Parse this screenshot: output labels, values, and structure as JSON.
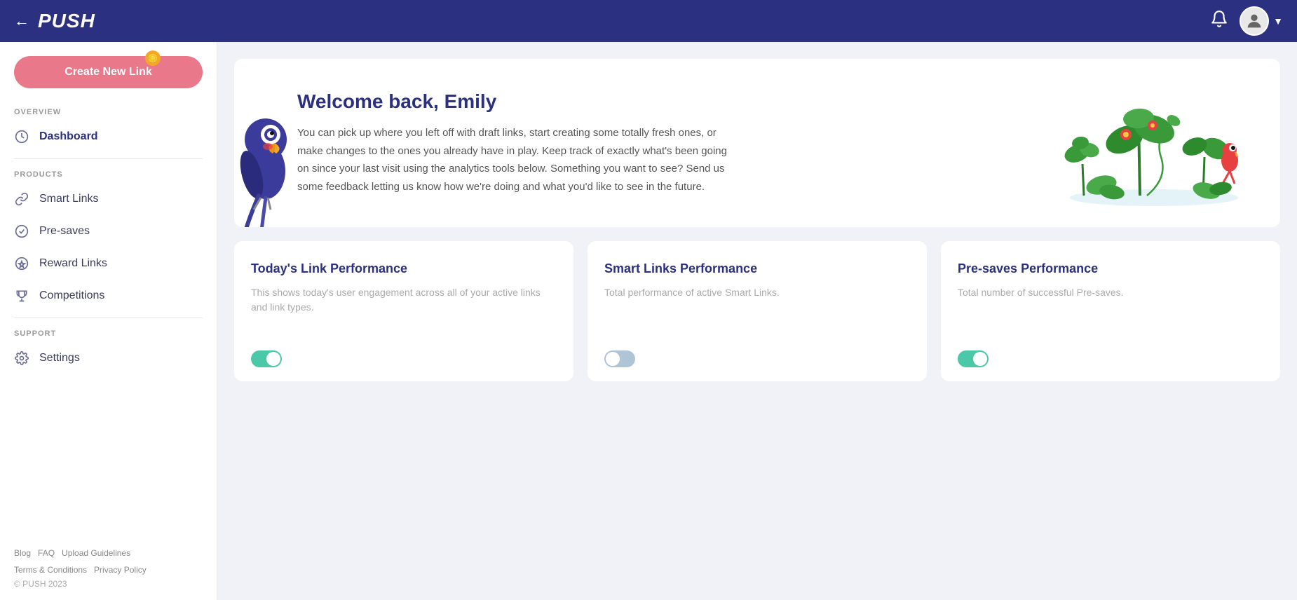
{
  "topnav": {
    "logo": "PUSH",
    "back_label": "←"
  },
  "sidebar": {
    "create_button_label": "Create New Link",
    "sections": [
      {
        "label": "OVERVIEW",
        "items": [
          {
            "id": "dashboard",
            "label": "Dashboard",
            "icon": "gauge"
          }
        ]
      },
      {
        "label": "PRODUCTS",
        "items": [
          {
            "id": "smart-links",
            "label": "Smart Links",
            "icon": "link"
          },
          {
            "id": "pre-saves",
            "label": "Pre-saves",
            "icon": "circle-check"
          },
          {
            "id": "reward-links",
            "label": "Reward Links",
            "icon": "star"
          },
          {
            "id": "competitions",
            "label": "Competitions",
            "icon": "trophy"
          }
        ]
      },
      {
        "label": "SUPPORT",
        "items": [
          {
            "id": "settings",
            "label": "Settings",
            "icon": "gear"
          }
        ]
      }
    ],
    "footer_links": [
      "Blog",
      "FAQ",
      "Upload Guidelines",
      "Terms & Conditions",
      "Privacy Policy"
    ],
    "copyright": "© PUSH 2023"
  },
  "welcome": {
    "title": "Welcome back, Emily",
    "body": "You can pick up where you left off with draft links, start creating some totally fresh ones, or make changes to the ones you already have in play. Keep track of exactly what's been going on since your last visit using the analytics tools below. Something you want to see? Send us some feedback letting us know how we're doing and what you'd like to see in the future."
  },
  "cards": [
    {
      "id": "todays-link-performance",
      "title": "Today's Link Performance",
      "subtitle": "This shows today's user engagement across all of your active links and link types.",
      "toggle": "on"
    },
    {
      "id": "smart-links-performance",
      "title": "Smart Links Performance",
      "subtitle": "Total performance of active Smart Links.",
      "toggle": "off"
    },
    {
      "id": "pre-saves-performance",
      "title": "Pre-saves Performance",
      "subtitle": "Total number of successful Pre-saves.",
      "toggle": "on"
    }
  ]
}
